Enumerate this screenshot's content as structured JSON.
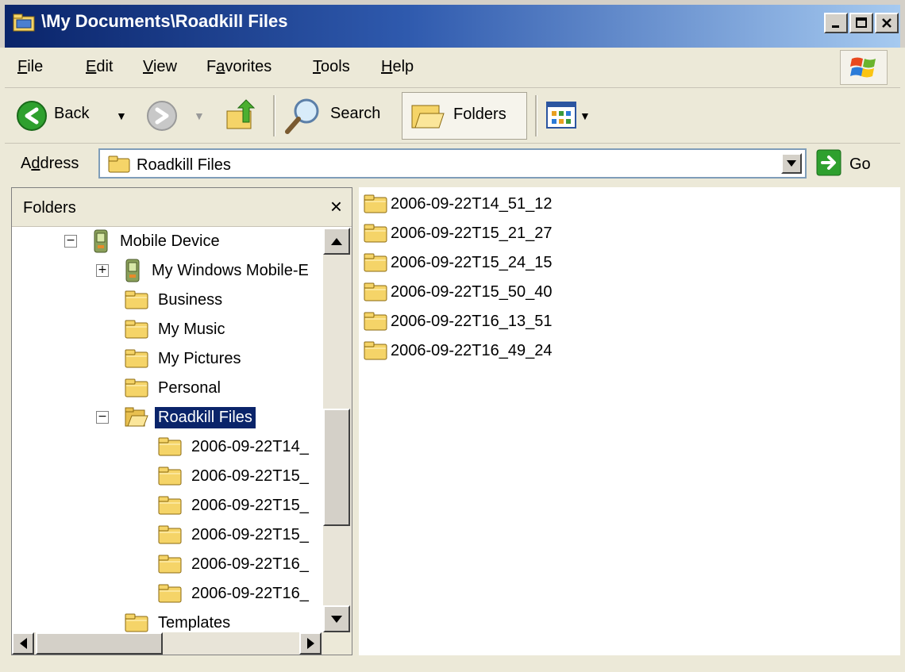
{
  "window": {
    "title": "\\My Documents\\Roadkill Files",
    "buttons": [
      "_",
      "□",
      "×"
    ]
  },
  "menu": [
    {
      "label": "File",
      "key": "F",
      "rest": "ile"
    },
    {
      "label": "Edit",
      "key": "E",
      "rest": "dit"
    },
    {
      "label": "View",
      "key": "V",
      "rest": "iew"
    },
    {
      "label": "Favorites",
      "key": "a",
      "pre": "F",
      "rest": "vorites"
    },
    {
      "label": "Tools",
      "key": "T",
      "rest": "ools"
    },
    {
      "label": "Help",
      "key": "H",
      "rest": "elp"
    }
  ],
  "toolbar": {
    "back_label": "Back",
    "search_label": "Search",
    "folders_label": "Folders"
  },
  "address": {
    "label_pre": "A",
    "label_key": "d",
    "label_rest": "dress",
    "value": "Roadkill Files",
    "go_label": "Go"
  },
  "folders_pane": {
    "header": "Folders",
    "close_glyph": "×",
    "tree": [
      {
        "label": "Mobile Device",
        "level": 0,
        "expander": "−",
        "icon": "mobile-device-icon"
      },
      {
        "label": "My Windows Mobile-E",
        "level": 1,
        "expander": "+",
        "icon": "mobile-device-icon"
      },
      {
        "label": "Business",
        "level": 1,
        "icon": "folder-icon"
      },
      {
        "label": "My Music",
        "level": 1,
        "icon": "folder-icon"
      },
      {
        "label": "My Pictures",
        "level": 1,
        "icon": "folder-icon"
      },
      {
        "label": "Personal",
        "level": 1,
        "icon": "folder-icon"
      },
      {
        "label": "Roadkill Files",
        "level": 1,
        "expander": "−",
        "icon": "open-folder-icon",
        "selected": true
      },
      {
        "label": "2006-09-22T14_",
        "level": 2,
        "icon": "folder-icon"
      },
      {
        "label": "2006-09-22T15_",
        "level": 2,
        "icon": "folder-icon"
      },
      {
        "label": "2006-09-22T15_",
        "level": 2,
        "icon": "folder-icon"
      },
      {
        "label": "2006-09-22T15_",
        "level": 2,
        "icon": "folder-icon"
      },
      {
        "label": "2006-09-22T16_",
        "level": 2,
        "icon": "folder-icon"
      },
      {
        "label": "2006-09-22T16_",
        "level": 2,
        "icon": "folder-icon"
      },
      {
        "label": "Templates",
        "level": 1,
        "icon": "folder-icon"
      }
    ]
  },
  "content": {
    "items": [
      {
        "label": "2006-09-22T14_51_12"
      },
      {
        "label": "2006-09-22T15_21_27"
      },
      {
        "label": "2006-09-22T15_24_15"
      },
      {
        "label": "2006-09-22T15_50_40"
      },
      {
        "label": "2006-09-22T16_13_51"
      },
      {
        "label": "2006-09-22T16_49_24"
      }
    ]
  },
  "colors": {
    "title_start": "#0A246A",
    "title_end": "#A6CAF0",
    "selection": "#0A246A",
    "folder": "#F5D468"
  }
}
